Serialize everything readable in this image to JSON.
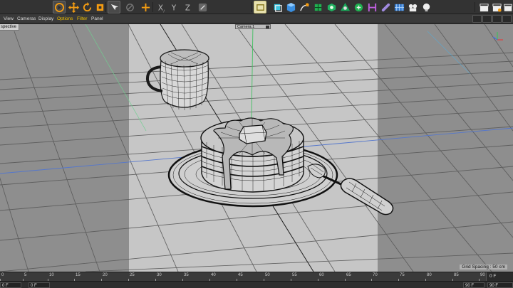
{
  "toolbar": {
    "tools": [
      {
        "icon": "live-selection-icon"
      },
      {
        "icon": "move-icon"
      },
      {
        "icon": "rotate-icon"
      },
      {
        "icon": "scale-icon"
      },
      {
        "icon": "select-group-icon"
      },
      {
        "icon": "model-icon"
      },
      {
        "icon": "world-axis-icon"
      },
      {
        "icon": "x-axis-lock-icon",
        "label": "X"
      },
      {
        "icon": "y-axis-lock-icon",
        "label": "Y"
      },
      {
        "icon": "z-axis-lock-icon",
        "label": "Z"
      },
      {
        "icon": "coordinate-system-icon"
      },
      {
        "icon": "render-region-icon"
      },
      {
        "icon": "cube-icon"
      },
      {
        "icon": "spline-pen-icon"
      },
      {
        "icon": "subdivision-icon"
      },
      {
        "icon": "cloner-icon"
      },
      {
        "icon": "deformer-icon"
      },
      {
        "icon": "scene-icon"
      },
      {
        "icon": "field-icon"
      },
      {
        "icon": "camera-icon"
      },
      {
        "icon": "light-icon"
      },
      {
        "icon": "render-view-icon"
      },
      {
        "icon": "render-picture-icon"
      },
      {
        "icon": "render-settings-icon"
      }
    ],
    "accent": "#f39c12",
    "highlight_color": "#3ec6e0"
  },
  "viewport_menu": {
    "items": [
      "View",
      "Cameras",
      "Display",
      "Options",
      "Filter",
      "Panel"
    ],
    "highlighted": [
      "Options",
      "Filter"
    ]
  },
  "viewport": {
    "view_name": "spective",
    "camera_name": "Camera.1",
    "grid_spacing": "Grid Spacing : 50 cm",
    "background_color": "#8f8f8f",
    "safe_frame_color": "#c9c9c9"
  },
  "timeline": {
    "ticks": [
      "0",
      "5",
      "10",
      "15",
      "20",
      "25",
      "30",
      "35",
      "40",
      "45",
      "50",
      "55",
      "60",
      "65",
      "70",
      "75",
      "80",
      "85",
      "90"
    ],
    "end_frame": "0 F"
  },
  "frame_bar": {
    "current_frame": "0 F",
    "start_frame": "0 F",
    "preview_end": "90 F",
    "end_frame": "90 F"
  }
}
